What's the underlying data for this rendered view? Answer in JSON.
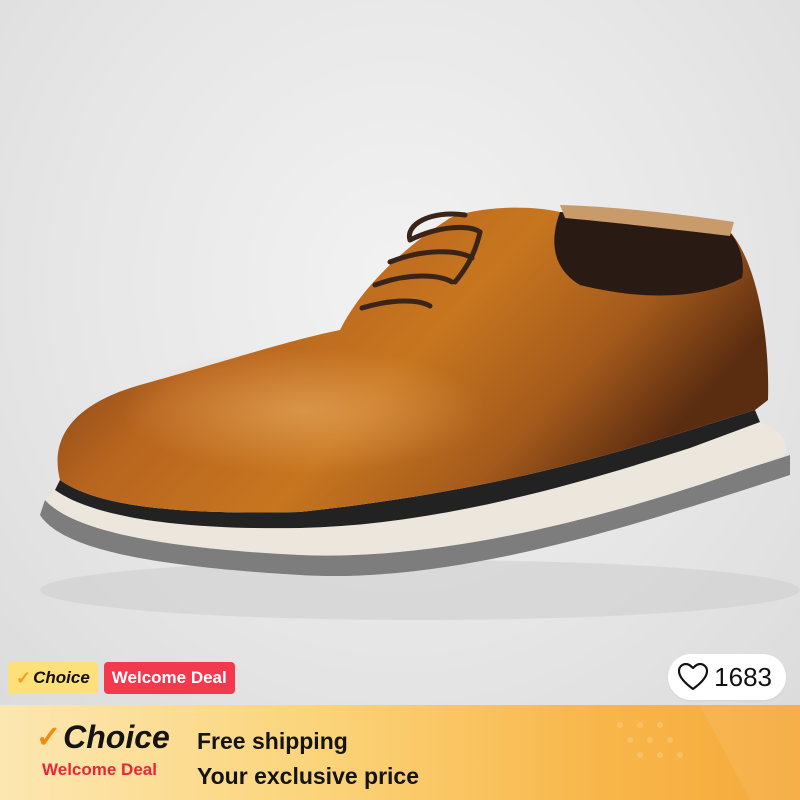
{
  "product": {
    "image_alt": "Brown leather whole-cut lace-up shoe with white sole"
  },
  "badges": {
    "choice_label": "Choice",
    "deal_label": "Welcome Deal"
  },
  "wishlist": {
    "count": "1683"
  },
  "banner": {
    "choice_label": "Choice",
    "welcome_label": "Welcome Deal",
    "line1": "Free shipping",
    "line2": "Your exclusive price"
  },
  "colors": {
    "choice_bg": "#fde07a",
    "deal_bg": "#f4394f",
    "banner_gradient_start": "#fce7b2",
    "banner_gradient_end": "#f6a93a",
    "welcome_text": "#e8263a"
  }
}
